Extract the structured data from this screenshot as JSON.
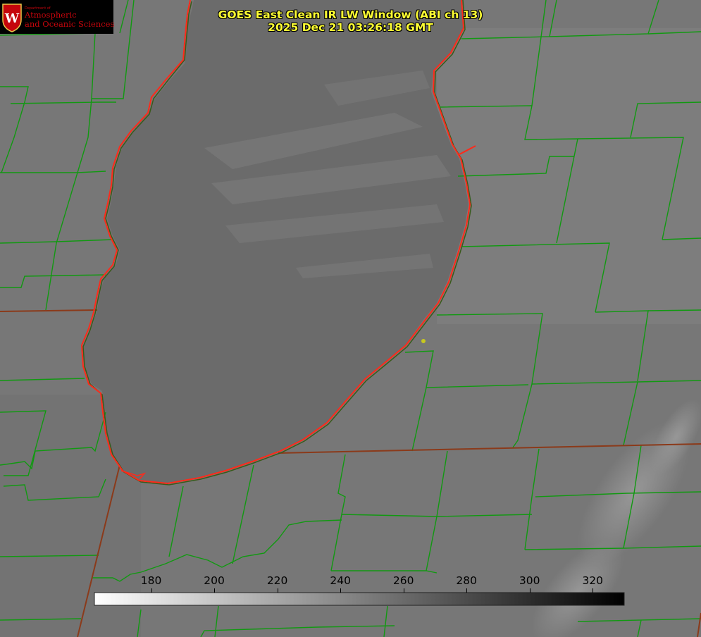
{
  "logo": {
    "department": "Department of",
    "line1": "Atmospheric",
    "line2": "and Oceanic Sciences"
  },
  "title": {
    "line1": "GOES East Clean IR LW Window (ABI ch 13)",
    "line2": "2025 Dec 21 03:26:18 GMT"
  },
  "colorbar": {
    "ticks": [
      "180",
      "200",
      "220",
      "240",
      "260",
      "280",
      "300",
      "320"
    ],
    "tick_values": [
      180,
      200,
      220,
      240,
      260,
      280,
      300,
      320
    ],
    "min": 162,
    "max": 330,
    "color_low": "#ffffff",
    "color_high": "#000000"
  },
  "colors": {
    "land": "#7a7a7a",
    "lake": "#6a6a6a",
    "coastline": "#ff2a1a",
    "county_lines": "#119911",
    "state_lines": "#8b3a1a",
    "title": "#ffff33",
    "station_marker": "#c8c81e"
  }
}
